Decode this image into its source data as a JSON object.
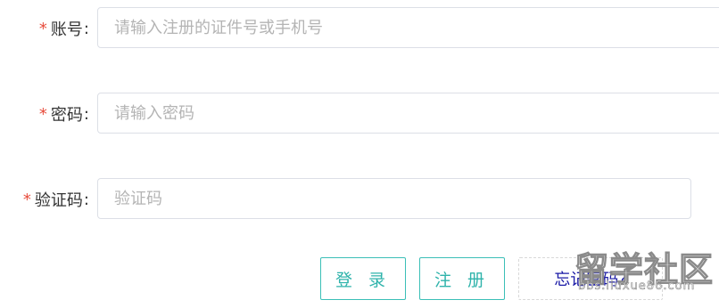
{
  "form": {
    "account": {
      "required_mark": "*",
      "label": "账号",
      "colon": ":",
      "placeholder": "请输入注册的证件号或手机号",
      "value": ""
    },
    "password": {
      "required_mark": "*",
      "label": "密码",
      "colon": ":",
      "placeholder": "请输入密码",
      "value": ""
    },
    "captcha": {
      "required_mark": "*",
      "label": "验证码",
      "colon": ":",
      "placeholder": "验证码",
      "value": ""
    }
  },
  "actions": {
    "login_label": "登 录",
    "register_label": "注 册",
    "forgot_label": "忘记密码?"
  },
  "watermark": {
    "text": "留学社区",
    "url_text": "bbs.liuxue86.com"
  },
  "colors": {
    "required": "#e74c3c",
    "button_accent": "#3bbfb7",
    "link": "#1a1aa6"
  }
}
